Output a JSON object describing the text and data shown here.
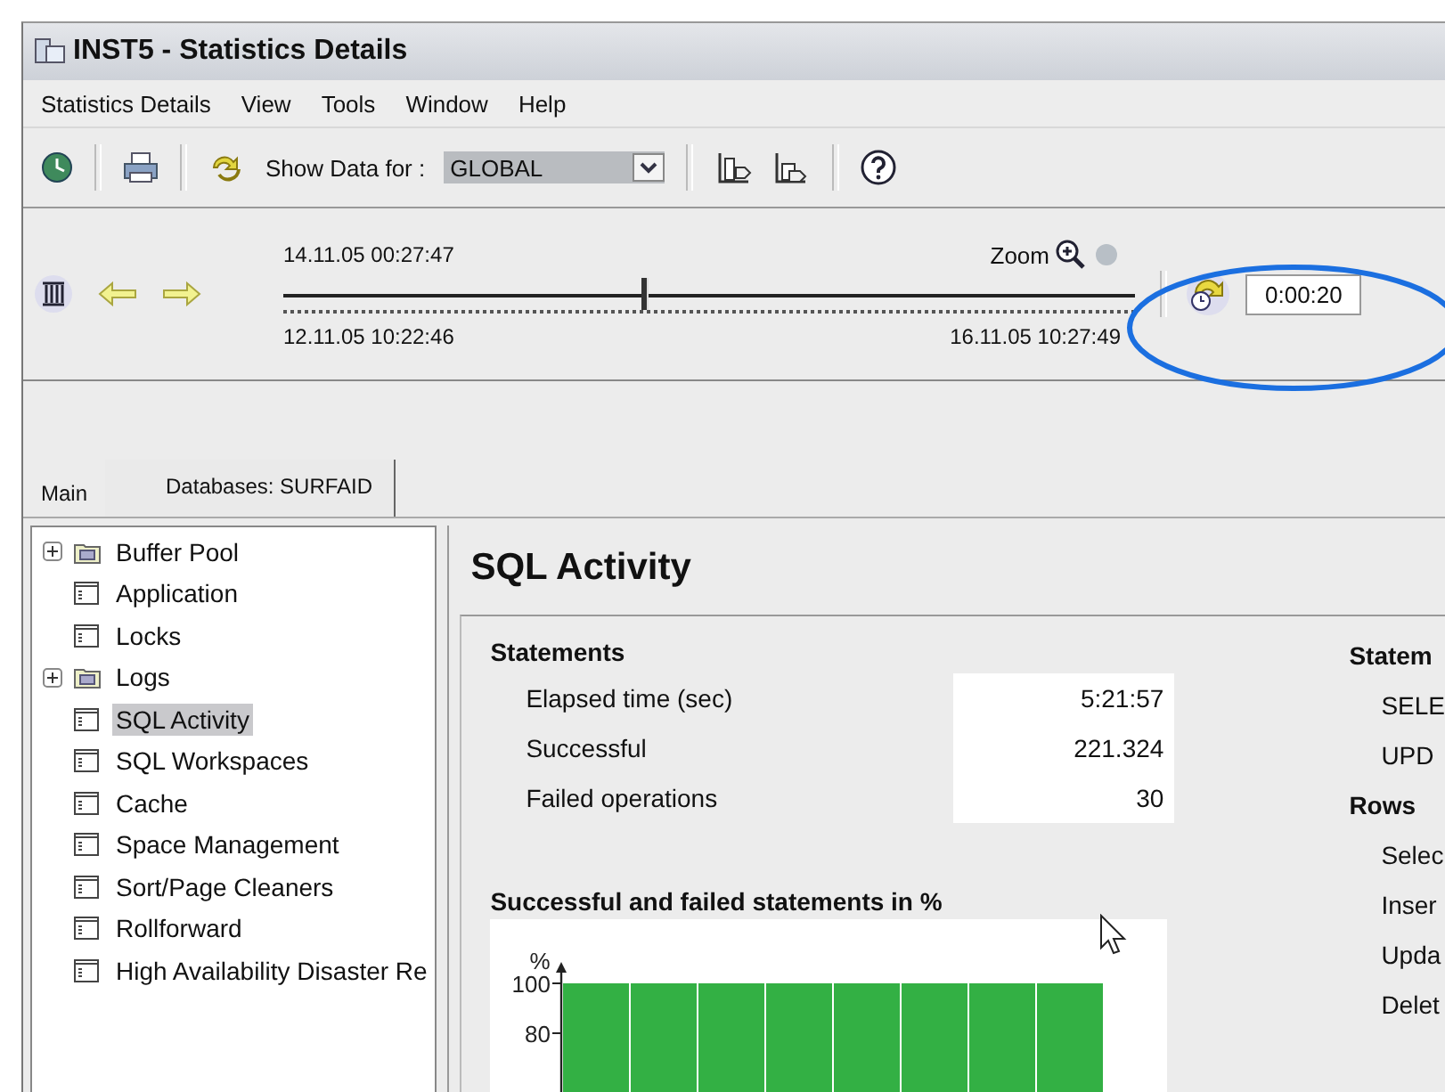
{
  "window": {
    "title": "INST5 - Statistics Details"
  },
  "menu": [
    "Statistics Details",
    "View",
    "Tools",
    "Window",
    "Help"
  ],
  "toolbar": {
    "show_data_label": "Show Data for :",
    "show_data_value": "GLOBAL"
  },
  "timeline": {
    "current": "14.11.05 00:27:47",
    "start": "12.11.05 10:22:46",
    "end": "16.11.05 10:27:49",
    "level": 0.42,
    "zoom_label": "Zoom",
    "interval": "0:00:20"
  },
  "tabs": [
    {
      "label": "Main",
      "selected": false
    },
    {
      "label": "Databases: SURFAID",
      "selected": true
    }
  ],
  "tree": [
    {
      "label": "Buffer Pool",
      "kind": "folder",
      "expanded": false,
      "selected": false
    },
    {
      "label": "Application",
      "kind": "page",
      "selected": false
    },
    {
      "label": "Locks",
      "kind": "page",
      "selected": false
    },
    {
      "label": "Logs",
      "kind": "folder",
      "expanded": false,
      "selected": false
    },
    {
      "label": "SQL Activity",
      "kind": "page",
      "selected": true
    },
    {
      "label": "SQL Workspaces",
      "kind": "page",
      "selected": false
    },
    {
      "label": "Cache",
      "kind": "page",
      "selected": false
    },
    {
      "label": "Space Management",
      "kind": "page",
      "selected": false
    },
    {
      "label": "Sort/Page Cleaners",
      "kind": "page",
      "selected": false
    },
    {
      "label": "Rollforward",
      "kind": "page",
      "selected": false
    },
    {
      "label": "High Availability Disaster Re",
      "kind": "page",
      "selected": false
    }
  ],
  "content": {
    "title": "SQL Activity",
    "statements": {
      "heading": "Statements",
      "rows": [
        {
          "label": "Elapsed time (sec)",
          "value": "5:21:57"
        },
        {
          "label": "Successful",
          "value": "221.324"
        },
        {
          "label": "Failed operations",
          "value": "30"
        }
      ]
    },
    "right_column": [
      {
        "text": "Statem",
        "kind": "heading"
      },
      {
        "text": "SELE",
        "kind": "item"
      },
      {
        "text": "UPD",
        "kind": "item"
      },
      {
        "text": "Rows",
        "kind": "heading"
      },
      {
        "text": "Selec",
        "kind": "item"
      },
      {
        "text": "Inser",
        "kind": "item"
      },
      {
        "text": "Upda",
        "kind": "item"
      },
      {
        "text": "Delet",
        "kind": "item"
      }
    ],
    "chart_title": "Successful and failed statements in %",
    "chart_data": {
      "type": "bar",
      "ylabel": "%",
      "ylim": [
        0,
        100
      ],
      "yticks": [
        80,
        100
      ],
      "series": [
        {
          "color": "#33b044",
          "values": [
            100,
            100,
            100,
            100,
            100,
            100,
            100,
            100
          ]
        }
      ]
    }
  }
}
